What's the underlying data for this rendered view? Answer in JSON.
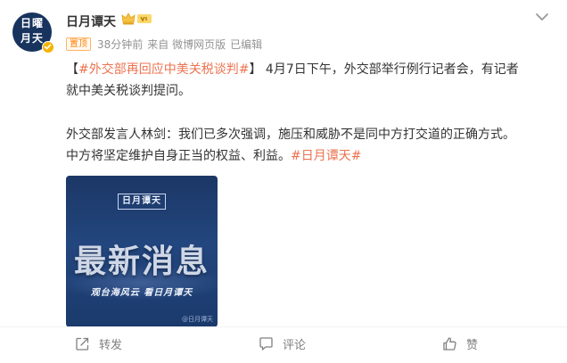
{
  "account": {
    "avatar_text": "日曜月天",
    "username": "日月谭天"
  },
  "meta": {
    "tag": "置顶",
    "time": "38分钟前",
    "source": "来自 微博网页版",
    "edited": "已编辑"
  },
  "post": {
    "bracket_open": "【",
    "topic1": "#外交部再回应中美关税谈判#",
    "bracket_close": "】",
    "line1_rest": "4月7日下午，外交部举行例行记者会，有记者",
    "line2": "就中美关税谈判提问。",
    "line3": "外交部发言人林剑：我们已多次强调，施压和威胁不是同中方打交道的正确方式。",
    "line4_text": "中方将坚定维护自身正当的权益、利益。",
    "topic2": "#日月谭天#"
  },
  "image": {
    "logo": "日月谭天",
    "headline": "最新消息",
    "subtitle": "观台海风云 看日月谭天",
    "watermark": "@日月谭天"
  },
  "actions": {
    "share": "转发",
    "comment": "评论",
    "like": "赞"
  },
  "colors": {
    "topic": "#eb7350",
    "meta": "#939393",
    "tag": "#ff8200",
    "image_bg": "#1f3d70"
  }
}
